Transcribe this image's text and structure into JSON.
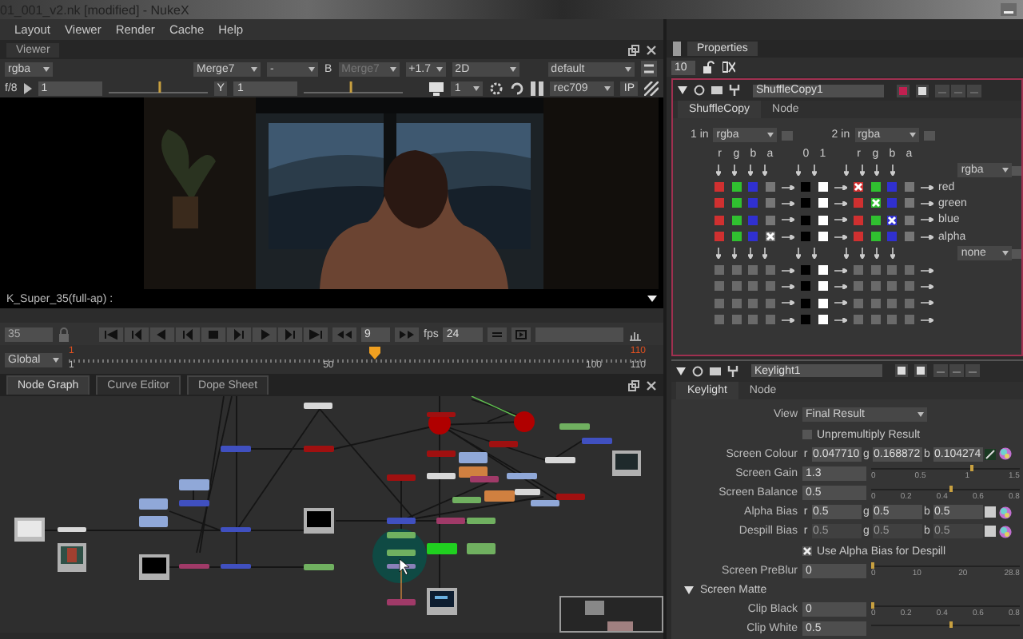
{
  "window": {
    "title": "01_001_v2.nk [modified] - NukeX"
  },
  "menu": [
    "Layout",
    "Viewer",
    "Render",
    "Cache",
    "Help"
  ],
  "viewer": {
    "tab": "Viewer",
    "toolbar": [
      {
        "kind": "dropdown",
        "value": "rgba",
        "disabled": false
      },
      {
        "kind": "dropdown",
        "value": "Merge7",
        "disabled": false
      },
      {
        "kind": "dropdown",
        "value": "-",
        "disabled": false
      },
      {
        "kind": "label",
        "value": "B"
      },
      {
        "kind": "dropdown",
        "value": "Merge7",
        "disabled": true
      },
      {
        "kind": "dropdown",
        "value": "+1.7",
        "disabled": false
      },
      {
        "kind": "dropdown",
        "value": "2D",
        "disabled": false
      },
      {
        "kind": "dropdown",
        "value": "default",
        "disabled": false
      }
    ],
    "fstop": "f/8",
    "gain": "1",
    "gain_slider": {
      "level": 0.52
    },
    "gamma_slider": {
      "level": 0.48
    },
    "gamma_button": "Y",
    "gamma": "1",
    "proxy": "1",
    "lut": "rec709",
    "ip_button": "IP",
    "format": "K_Super_35(full-ap) :"
  },
  "playback": {
    "frame": "35",
    "increment": "9",
    "fps_label": "fps",
    "fps": "24"
  },
  "timeline": {
    "scope": "Global",
    "in_point": "1",
    "out_point": "110",
    "ticks": [
      "1",
      "50",
      "100",
      "110"
    ],
    "level": 0.53
  },
  "graph_tabs": [
    {
      "label": "Node Graph",
      "selected": true
    },
    {
      "label": "Curve Editor",
      "selected": false
    },
    {
      "label": "Dope Sheet",
      "selected": false
    }
  ],
  "properties": {
    "tab": "Properties",
    "max_panels": "10"
  },
  "shuffle": {
    "name": "ShuffleCopy1",
    "tabs": [
      {
        "label": "ShuffleCopy",
        "selected": true
      },
      {
        "label": "Node",
        "selected": false
      }
    ],
    "in1_label": "1 in",
    "in1": "rgba",
    "in2_label": "2 in",
    "in2": "rgba",
    "letters": [
      "r",
      "g",
      "b",
      "a",
      "0",
      "1",
      "r",
      "g",
      "b",
      "a"
    ],
    "out_layers": [
      "rgba",
      "none"
    ],
    "rows": [
      {
        "active": true,
        "label": "red",
        "checked": [
          false,
          false,
          false,
          false,
          false,
          false,
          true,
          false,
          false,
          false
        ]
      },
      {
        "active": true,
        "label": "green",
        "checked": [
          false,
          false,
          false,
          false,
          false,
          false,
          false,
          true,
          false,
          false
        ]
      },
      {
        "active": true,
        "label": "blue",
        "checked": [
          false,
          false,
          false,
          false,
          false,
          false,
          false,
          false,
          true,
          false
        ]
      },
      {
        "active": true,
        "label": "alpha",
        "checked": [
          false,
          false,
          false,
          true,
          false,
          false,
          false,
          false,
          false,
          false
        ]
      },
      {
        "active": false,
        "checked": [
          false,
          false,
          false,
          false,
          false,
          false,
          false,
          false,
          false,
          false
        ]
      },
      {
        "active": false,
        "checked": [
          false,
          false,
          false,
          false,
          false,
          false,
          false,
          false,
          false,
          false
        ]
      },
      {
        "active": false,
        "checked": [
          false,
          false,
          false,
          false,
          false,
          false,
          false,
          false,
          false,
          false
        ]
      },
      {
        "active": false,
        "checked": [
          false,
          false,
          false,
          false,
          false,
          false,
          false,
          false,
          false,
          false
        ]
      }
    ]
  },
  "keylight": {
    "name": "Keylight1",
    "tabs": [
      {
        "label": "Keylight",
        "selected": true
      },
      {
        "label": "Node",
        "selected": false
      }
    ],
    "params": [
      {
        "kind": "dropdown",
        "label": "View",
        "value": "Final Result"
      },
      {
        "kind": "checkbox",
        "label": "Unpremultiply Result",
        "checked": false
      },
      {
        "kind": "rgb",
        "label": "Screen Colour",
        "disabled": false,
        "values": [
          {
            "channel": "r",
            "value": "0.047710"
          },
          {
            "channel": "g",
            "value": "0.168872"
          },
          {
            "channel": "b",
            "value": "0.104274"
          }
        ]
      },
      {
        "kind": "slider",
        "label": "Screen Gain",
        "value": "1.3",
        "level": 0.67,
        "ticks": [
          "0",
          "0.5",
          "1",
          "1.5"
        ]
      },
      {
        "kind": "slider",
        "label": "Screen Balance",
        "value": "0.5",
        "level": 0.53,
        "ticks": [
          "0",
          "0.2",
          "0.4",
          "0.6",
          "0.8"
        ]
      },
      {
        "kind": "rgb",
        "label": "Alpha Bias",
        "disabled": false,
        "values": [
          {
            "channel": "r",
            "value": "0.5"
          },
          {
            "channel": "g",
            "value": "0.5"
          },
          {
            "channel": "b",
            "value": "0.5"
          }
        ]
      },
      {
        "kind": "rgb",
        "label": "Despill Bias",
        "disabled": true,
        "values": [
          {
            "channel": "r",
            "value": "0.5"
          },
          {
            "channel": "g",
            "value": "0.5"
          },
          {
            "channel": "b",
            "value": "0.5"
          }
        ]
      },
      {
        "kind": "checkbox",
        "label": "Use Alpha Bias for Despill",
        "checked": true
      },
      {
        "kind": "slider",
        "label": "Screen PreBlur",
        "value": "0",
        "level": 0,
        "ticks": [
          "0",
          "10",
          "20",
          "28.8"
        ]
      },
      {
        "kind": "section",
        "label": "Screen Matte",
        "expanded": true
      },
      {
        "kind": "slider",
        "label": "Clip Black",
        "value": "0",
        "level": 0,
        "ticks": [
          "0",
          "0.2",
          "0.4",
          "0.6",
          "0.8"
        ]
      },
      {
        "kind": "slider",
        "label": "Clip White",
        "value": "0.5",
        "level": 0.53
      }
    ]
  }
}
